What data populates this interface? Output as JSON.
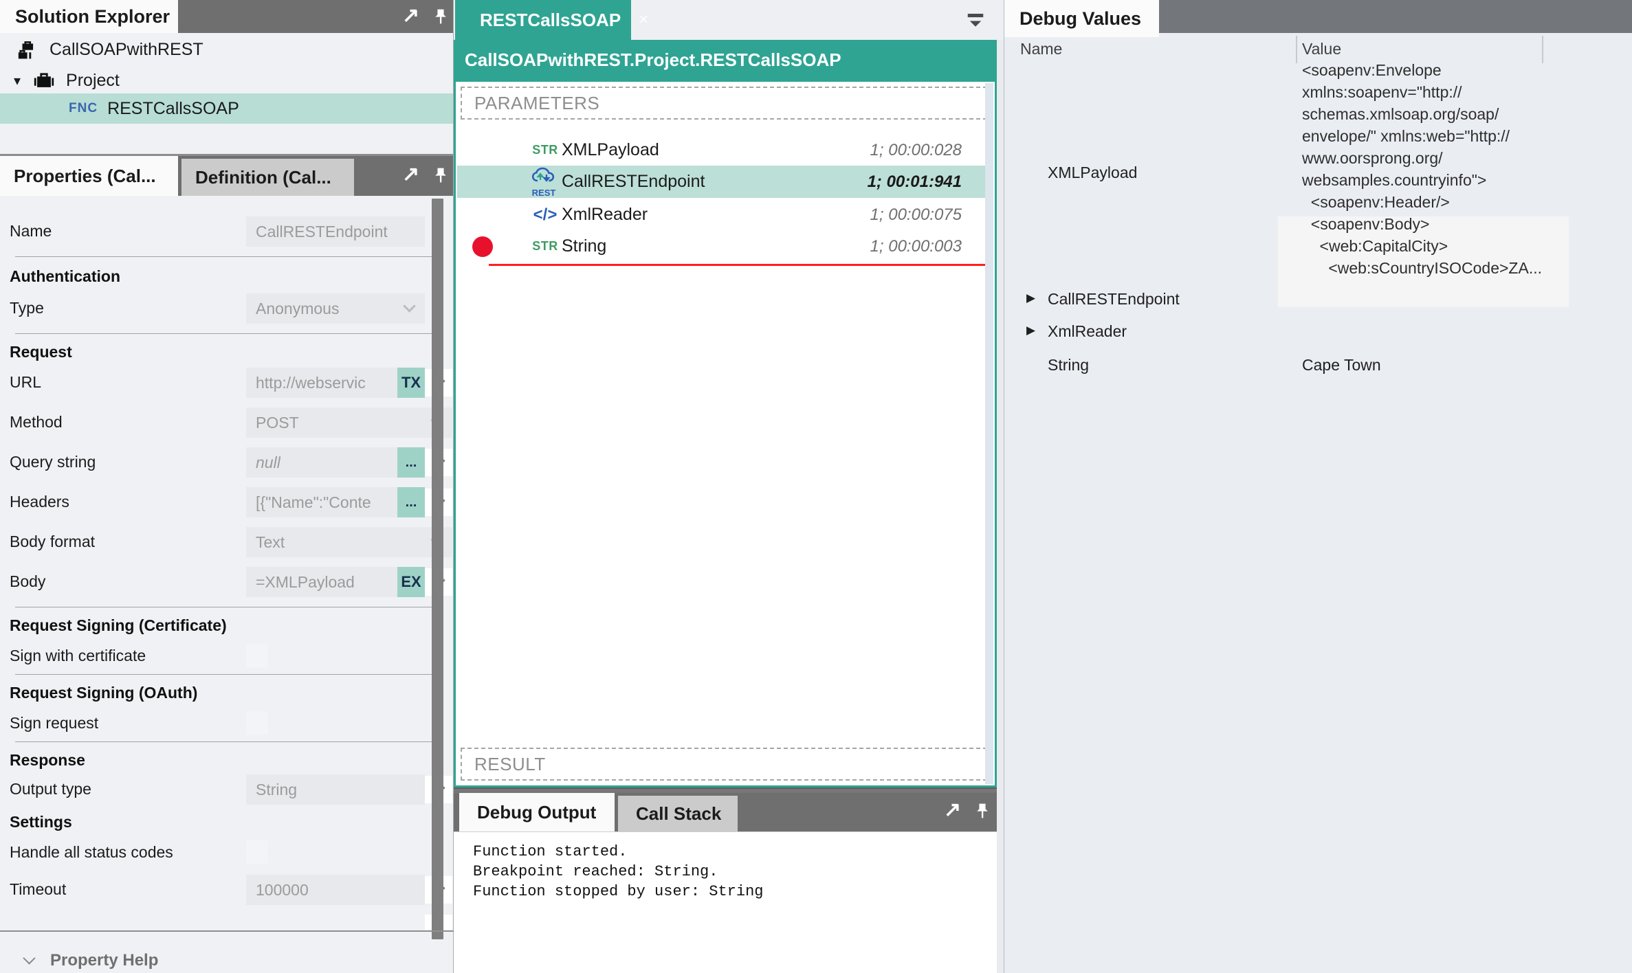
{
  "solution_explorer": {
    "title": "Solution Explorer",
    "items": [
      {
        "label": "CallSOAPwithREST"
      },
      {
        "caret": "▾",
        "label": "Project"
      },
      {
        "prefix": "FNC",
        "label": "RESTCallsSOAP"
      }
    ]
  },
  "properties": {
    "tabs": [
      {
        "label": "Properties (Cal..."
      },
      {
        "label": "Definition (Cal..."
      }
    ],
    "rows": [
      {
        "label": "Name",
        "value": "CallRESTEndpoint"
      },
      {
        "label": "Authentication"
      },
      {
        "label": "Type",
        "value": "Anonymous"
      },
      {
        "label": "Request"
      },
      {
        "label": "URL",
        "value": "http://webservic",
        "badge": "TX"
      },
      {
        "label": "Method",
        "value": "POST"
      },
      {
        "label": "Query string",
        "value": "null",
        "badge": "..."
      },
      {
        "label": "Headers",
        "value": "[{\"Name\":\"Conte",
        "badge": "..."
      },
      {
        "label": "Body format",
        "value": "Text"
      },
      {
        "label": "Body",
        "value": "=XMLPayload",
        "badge": "EX"
      },
      {
        "label": "Request Signing (Certificate)"
      },
      {
        "label": "Sign with certificate"
      },
      {
        "label": "Request Signing (OAuth)"
      },
      {
        "label": "Sign request"
      },
      {
        "label": "Response"
      },
      {
        "label": "Output type",
        "value": "String"
      },
      {
        "label": "Settings"
      },
      {
        "label": "Handle all status codes"
      },
      {
        "label": "Timeout",
        "value": "100000"
      }
    ],
    "property_help": "Property Help"
  },
  "editor": {
    "tab": "RESTCallsSOAP",
    "close": "×",
    "breadcrumb": "CallSOAPwithREST.Project.RESTCallsSOAP",
    "parameters_label": "PARAMETERS",
    "result_label": "RESULT",
    "steps": [
      {
        "icon": "STR",
        "name": "XMLPayload",
        "timing": "1; 00:00:028"
      },
      {
        "icon": "REST",
        "name": "CallRESTEndpoint",
        "timing": "1; 00:01:941",
        "selected": true
      },
      {
        "icon": "</>",
        "name": "XmlReader",
        "timing": "1; 00:00:075"
      },
      {
        "icon": "STR",
        "name": "String",
        "timing": "1; 00:00:003",
        "breakpoint": true
      }
    ]
  },
  "debug_output": {
    "tabs": [
      {
        "label": "Debug Output"
      },
      {
        "label": "Call Stack"
      }
    ],
    "lines": [
      "Function started.",
      "Breakpoint reached: String.",
      "Function stopped by user: String"
    ]
  },
  "debug_values": {
    "title": "Debug Values",
    "columns": [
      {
        "label": "Name"
      },
      {
        "label": "Value"
      }
    ],
    "xml_payload": {
      "name": "XMLPayload",
      "lines": [
        "<soapenv:Envelope",
        "xmlns:soapenv=\"http://",
        "schemas.xmlsoap.org/soap/",
        "envelope/\" xmlns:web=\"http://",
        "www.oorsprong.org/",
        "websamples.countryinfo\">",
        "  <soapenv:Header/>",
        "  <soapenv:Body>",
        "    <web:CapitalCity>",
        "      <web:sCountryISOCode>ZA..."
      ]
    },
    "rows": [
      {
        "expander": "▶",
        "name": "CallRESTEndpoint"
      },
      {
        "expander": "▶",
        "name": "XmlReader"
      }
    ],
    "string_row": {
      "name": "String",
      "value": "Cape Town"
    }
  },
  "colors": {
    "accent_teal": "#2FA493",
    "selection_teal": "#BCDFD7",
    "badge_teal": "#9FD2C7",
    "breakpoint_red": "#E8112D"
  }
}
